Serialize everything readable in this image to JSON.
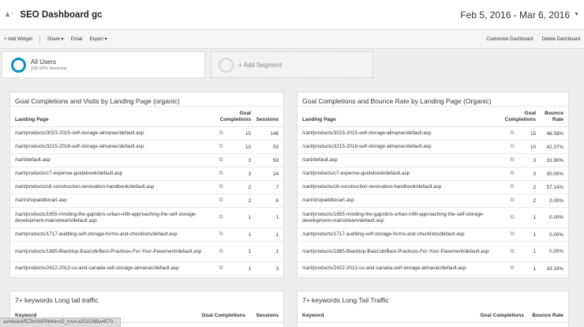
{
  "header": {
    "title": "SEO Dashboard gc",
    "date_range": "Feb 5, 2016 - Mar 6, 2016"
  },
  "toolbar": {
    "add_widget": "+ Add Widget",
    "share": "Share ▾",
    "email": "Email",
    "export": "Export ▾",
    "customize": "Customize Dashboard",
    "delete": "Delete Dashboard"
  },
  "segments": {
    "all_users": {
      "name": "All Users",
      "sub": "100.00% Sessions"
    },
    "add_segment": "+ Add Segment"
  },
  "widgets": {
    "visits": {
      "title": "Goal Completions and Visits by Landing Page (organic)",
      "col1": "Landing Page",
      "col2": "Goal Completions",
      "col3": "Sessions",
      "rows": [
        {
          "page": "/cart/products/3023-2015-self-storage-almanac/default.asp",
          "goal": "15",
          "sessions": "146"
        },
        {
          "page": "/cart/products/3215-2016-self-storage-almanac/default.asp",
          "goal": "10",
          "sessions": "59"
        },
        {
          "page": "/cart/default.asp",
          "goal": "3",
          "sessions": "59"
        },
        {
          "page": "/cart/products/c7-expense-guidebook/default.asp",
          "goal": "3",
          "sessions": "24"
        },
        {
          "page": "/cart/products/c6-construction-renovation-handbook/default.asp",
          "goal": "2",
          "sessions": "7"
        },
        {
          "page": "/cart/shopaddtocart.asp",
          "goal": "2",
          "sessions": "6"
        },
        {
          "page": "/cart/products/1655-minding-the-gapsbris-urban-infill-approaching-the-self-storage-development-mainstream/default.asp",
          "goal": "1",
          "sessions": "1"
        },
        {
          "page": "/cart/products/1717-auditing-self-storage-forms-and-checklists/default.asp",
          "goal": "1",
          "sessions": "1"
        },
        {
          "page": "/cart/products/1885-Blacktop-BasicsbrBest-Practices-For-Your-Pavement/default.asp",
          "goal": "1",
          "sessions": "1"
        },
        {
          "page": "/cart/products/2422-2012-us-and-canada-self-storage-almanac/default.asp",
          "goal": "1",
          "sessions": "3"
        }
      ]
    },
    "bounce": {
      "title": "Goal Completions and Bounce Rate by Landing Page (Organic)",
      "col1": "Landing Page",
      "col2": "Goal Completions",
      "col3": "Bounce Rate",
      "rows": [
        {
          "page": "/cart/products/3023-2015-self-storage-almanac/default.asp",
          "goal": "15",
          "rate": "46.58%"
        },
        {
          "page": "/cart/products/3215-2016-self-storage-almanac/default.asp",
          "goal": "10",
          "rate": "42.37%"
        },
        {
          "page": "/cart/default.asp",
          "goal": "3",
          "rate": "33.90%"
        },
        {
          "page": "/cart/products/c7-expense-guidebook/default.asp",
          "goal": "3",
          "rate": "50.00%"
        },
        {
          "page": "/cart/products/c6-construction-renovation-handbook/default.asp",
          "goal": "2",
          "rate": "57.14%"
        },
        {
          "page": "/cart/shopaddtocart.asp",
          "goal": "2",
          "rate": "0.00%"
        },
        {
          "page": "/cart/products/1655-minding-the-gapsbris-urban-infill-approaching-the-self-storage-development-mainstream/default.asp",
          "goal": "1",
          "rate": "0.00%"
        },
        {
          "page": "/cart/products/1717-auditing-self-storage-forms-and-checklists/default.asp",
          "goal": "1",
          "rate": "0.00%"
        },
        {
          "page": "/cart/products/1885-Blacktop-BasicsbrBest-Practices-For-Your-Pavement/default.asp",
          "goal": "1",
          "rate": "0.00%"
        },
        {
          "page": "/cart/products/2422-2012-us-and-canada-self-storage-almanac/default.asp",
          "goal": "1",
          "rate": "33.33%"
        }
      ]
    },
    "longtail1": {
      "title": "7+ keywords Long tail traffic",
      "col1": "Keyword",
      "col2": "Goal Completions",
      "col3": "Sessions"
    },
    "longtail2": {
      "title": "7+ keywords Long Tail Traffic",
      "col1": "Keyword",
      "col2": "Goal Completions",
      "col3": "Bounce Rate"
    }
  },
  "status_url": "ashboard/fEZbrXbPRbKkvcD_lrIvA/a2515385w4570..."
}
